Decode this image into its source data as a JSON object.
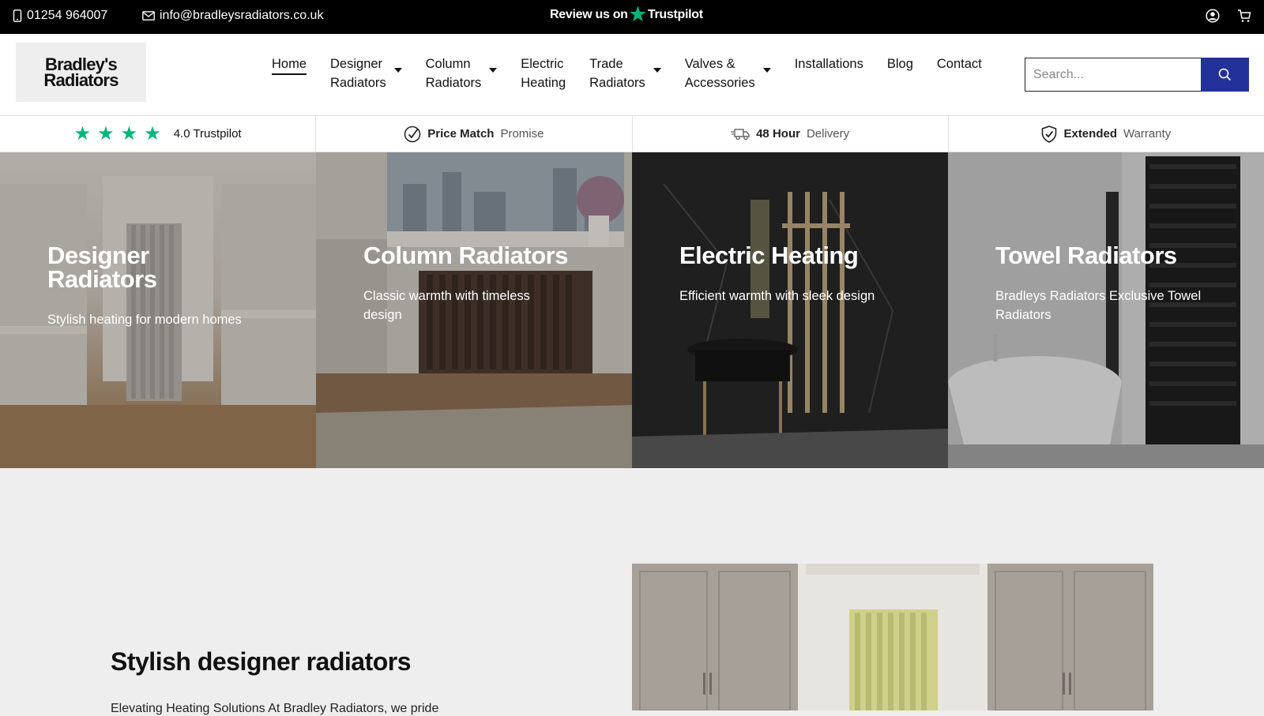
{
  "topbar": {
    "phone": "01254 964007",
    "email": "info@bradleysradiators.co.uk",
    "review_prefix": "Review us on",
    "review_brand": "Trustpilot",
    "icons": [
      "phone-icon",
      "mail-icon",
      "trustpilot-star-icon",
      "account-icon",
      "cart-icon"
    ]
  },
  "header": {
    "logo_line1": "Bradley's",
    "logo_line2": "Radiators",
    "nav": [
      {
        "label": "Home",
        "active": true,
        "dropdown": false
      },
      {
        "label": "Designer Radiators",
        "line1": "Designer",
        "line2": "Radiators",
        "dropdown": true
      },
      {
        "label": "Column Radiators",
        "line1": "Column",
        "line2": "Radiators",
        "dropdown": true
      },
      {
        "label": "Electric Heating",
        "line1": "Electric",
        "line2": "Heating",
        "dropdown": false
      },
      {
        "label": "Trade Radiators",
        "line1": "Trade",
        "line2": "Radiators",
        "dropdown": true
      },
      {
        "label": "Valves & Accessories",
        "line1": "Valves &",
        "line2": "Accessories",
        "dropdown": true
      },
      {
        "label": "Installations",
        "dropdown": false
      },
      {
        "label": "Blog",
        "dropdown": false
      },
      {
        "label": "Contact",
        "dropdown": false
      }
    ],
    "search_placeholder": "Search..."
  },
  "usp": [
    {
      "strong": "4.0 Trustpilot",
      "light": ""
    },
    {
      "strong": "Price Match",
      "light": "Promise"
    },
    {
      "strong": "48 Hour",
      "light": "Delivery"
    },
    {
      "strong": "Extended",
      "light": "Warranty"
    }
  ],
  "tiles": [
    {
      "title": "Designer Radiators",
      "subtitle": "Stylish heating for modern homes"
    },
    {
      "title": "Column Radiators",
      "subtitle": "Classic warmth with timeless design"
    },
    {
      "title": "Electric Heating",
      "subtitle": "Efficient warmth with sleek design"
    },
    {
      "title": "Towel Radiators",
      "subtitle": "Bradleys Radiators Exclusive Towel Radiators"
    }
  ],
  "section": {
    "title": "Stylish designer radiators",
    "text": "Elevating Heating Solutions At Bradley Radiators, we pride"
  },
  "colors": {
    "topbar_bg": "#000000",
    "trustpilot_green": "#00b67a",
    "search_button": "#22329a",
    "page_bg": "#eeeeee"
  }
}
